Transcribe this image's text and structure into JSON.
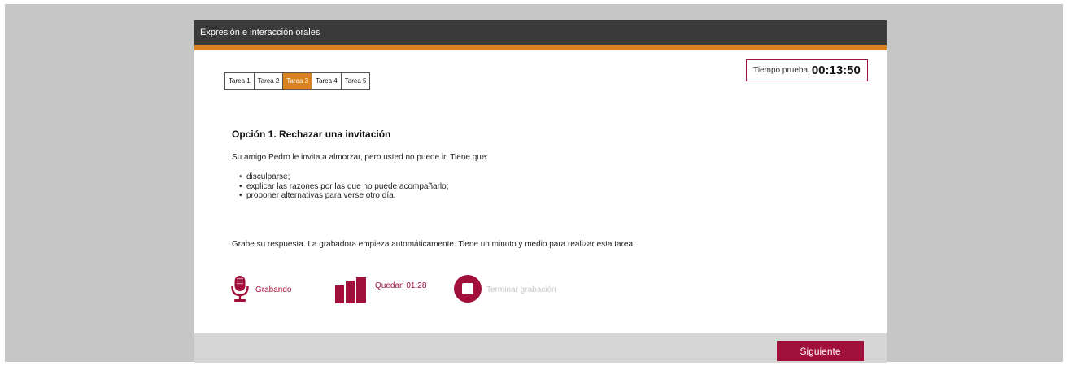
{
  "window": {
    "title": "Expresión e interacción orales"
  },
  "tabs": [
    {
      "label": "Tarea 1",
      "active": false
    },
    {
      "label": "Tarea 2",
      "active": false
    },
    {
      "label": "Tarea 3",
      "active": true
    },
    {
      "label": "Tarea 4",
      "active": false
    },
    {
      "label": "Tarea 5",
      "active": false
    }
  ],
  "timer": {
    "label": "Tiempo prueba:",
    "value": "00:13:50"
  },
  "task": {
    "title": "Opción 1. Rechazar una invitación",
    "intro": "Su amigo Pedro le invita a almorzar, pero usted no puede ir. Tiene que:",
    "bullets": [
      "disculparse;",
      "explicar las razones por las que no puede acompañarlo;",
      "proponer alternativas para verse otro día."
    ],
    "instructions": "Grabe su respuesta. La grabadora empieza automáticamente. Tiene un minuto y medio para realizar esta tarea."
  },
  "recorder": {
    "status_label": "Grabando",
    "remaining_label": "Quedan 01:28",
    "stop_label": "Terminar grabación",
    "status_icon": "microphone-icon",
    "level_icon": "audio-level-icon",
    "stop_icon": "stop-icon"
  },
  "footer": {
    "next_label": "Siguiente"
  },
  "colors": {
    "accent": "#a0103a",
    "orange": "#d9831f",
    "titlebar": "#3a3a3a",
    "backdrop": "#c6c6c6",
    "footer": "#d6d6d6"
  }
}
